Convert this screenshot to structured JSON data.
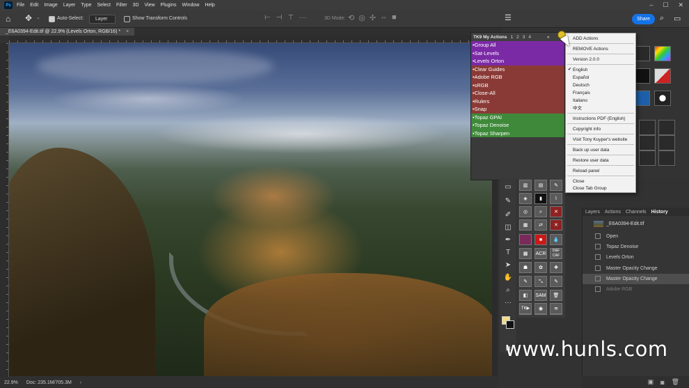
{
  "menubar": {
    "items": [
      "File",
      "Edit",
      "Image",
      "Layer",
      "Type",
      "Select",
      "Filter",
      "3D",
      "View",
      "Plugins",
      "Window",
      "Help"
    ],
    "window_controls": [
      "–",
      "☐",
      "✕"
    ]
  },
  "options": {
    "auto_select_label": "Auto-Select:",
    "auto_select_checked": true,
    "layer_value": "Layer",
    "show_transform_label": "Show Transform Controls",
    "mode3d_label": "3D Mode:",
    "share_label": "Share"
  },
  "document": {
    "tab_title": "_E6A0394-Edit.tif @ 22.9% (Levels Orton, RGB/16) *",
    "ruler_top": [
      "0",
      "4",
      "2",
      "4",
      "6",
      "8",
      "10",
      "12",
      "14",
      "16",
      "18",
      "20",
      "22",
      "24"
    ],
    "ruler_left": [
      "0",
      "1",
      "2",
      "3",
      "4",
      "5",
      "6",
      "7",
      "8",
      "9",
      "10",
      "11"
    ]
  },
  "status": {
    "zoom": "22.9%",
    "doc": "Doc: 235.1M/705.3M"
  },
  "tk9": {
    "title": "TK9 My Actions",
    "tabs": [
      "1",
      "2",
      "3",
      "4"
    ],
    "arrow": "»",
    "items": [
      {
        "label": "•Group All",
        "color": "#7b2aa6"
      },
      {
        "label": "•Sat-Levels",
        "color": "#7b2aa6"
      },
      {
        "label": "•Levels Orton",
        "color": "#7b2aa6"
      },
      {
        "label": "•Clear Guides",
        "color": "#8a3a36"
      },
      {
        "label": "•Adobe RGB",
        "color": "#8a3a36"
      },
      {
        "label": "•sRGB",
        "color": "#8a3a36"
      },
      {
        "label": "•Close-All",
        "color": "#8a3a36"
      },
      {
        "label": "•Rulers",
        "color": "#8a3a36"
      },
      {
        "label": "•Snap",
        "color": "#8a3a36"
      },
      {
        "label": "•Topaz GPAI",
        "color": "#3f8a3a"
      },
      {
        "label": "•Topaz Denoise",
        "color": "#3f8a3a"
      },
      {
        "label": "•Topaz Sharpen",
        "color": "#3f8a3a"
      }
    ]
  },
  "dropdown": {
    "add_actions": "ADD Actions",
    "remove_actions": "REMOVE Actions",
    "version": "Version 2.0.0",
    "languages": [
      "English",
      "Español",
      "Deutsch",
      "Français",
      "Italiano",
      "中文"
    ],
    "selected_language": "English",
    "instructions": "Instructions PDF (English)",
    "copyright": "Copyright info",
    "visit": "Visit Tony Kuyper's website",
    "backup": "Back up user data",
    "restore": "Restore user data",
    "reload": "Reload panel",
    "close": "Close",
    "close_tab_group": "Close Tab Group"
  },
  "toolgrid": {
    "acr": "ACR",
    "dcaf": "D&F CAF",
    "sam": "SAM",
    "tk": "TK▶",
    "c": "©"
  },
  "history": {
    "tabs": [
      "Layers",
      "Actions",
      "Channels",
      "History"
    ],
    "active_tab": "History",
    "snapshot": "_E6A0394-Edit.tif",
    "steps": [
      {
        "label": "Open",
        "state": "normal"
      },
      {
        "label": "Topaz Denoise",
        "state": "normal"
      },
      {
        "label": "Levels Orton",
        "state": "normal"
      },
      {
        "label": "Master Opacity Change",
        "state": "normal"
      },
      {
        "label": "Master Opacity Change",
        "state": "selected"
      },
      {
        "label": "Adobe RGB",
        "state": "dim"
      }
    ]
  },
  "watermark": "www.hunls.com",
  "colors": {
    "foreground": "#f2dc8a",
    "background": "#111111",
    "accent": "#1473e6",
    "tk9_purple": "#7b2aa6",
    "tk9_brown": "#8a3a36",
    "tk9_green": "#3f8a3a"
  }
}
